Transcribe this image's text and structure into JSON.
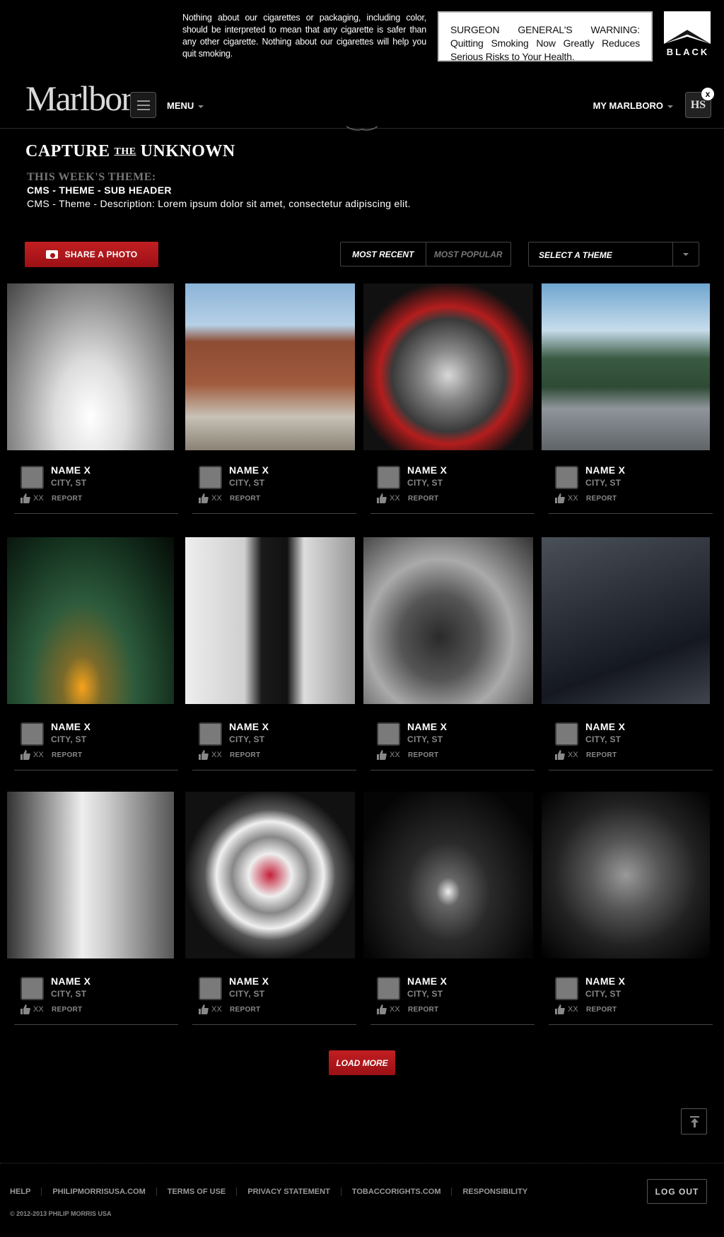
{
  "warning": {
    "disclaimer": "Nothing about our cigarettes or packaging, including color, should be interpreted to mean that any cigarette is safer than any other cigarette. Nothing about our cigarettes will help you quit smoking.",
    "surgeon_general": "SURGEON GENERAL'S WARNING: Quitting Smoking Now Greatly Reduces Serious Risks to Your Health.",
    "black_logo": "BLACK"
  },
  "nav": {
    "brand": "Marlboro",
    "menu_label": "MENU",
    "my_marlboro": "MY MARLBORO",
    "hs_badge": "HS",
    "close": "x"
  },
  "theme": {
    "capture_left": "CAPTURE",
    "capture_the": "THE",
    "capture_right": "UNKNOWN",
    "weeks_theme": "THIS WEEK'S THEME:",
    "sub_header": "CMS - THEME - SUB HEADER",
    "description": "CMS - Theme - Description: Lorem ipsum dolor sit amet, consectetur adipiscing elit."
  },
  "controls": {
    "share": "SHARE A PHOTO",
    "most_recent": "MOST RECENT",
    "most_popular": "MOST POPULAR",
    "select_theme": "SELECT A THEME"
  },
  "photos": [
    {
      "name": "NAME X",
      "city": "CITY, ST",
      "likes": "XX",
      "report": "REPORT",
      "scene": "snowy-forest-road"
    },
    {
      "name": "NAME X",
      "city": "CITY, ST",
      "likes": "XX",
      "report": "REPORT",
      "scene": "canyon-road"
    },
    {
      "name": "NAME X",
      "city": "CITY, ST",
      "likes": "XX",
      "report": "REPORT",
      "scene": "car-engine"
    },
    {
      "name": "NAME X",
      "city": "CITY, ST",
      "likes": "XX",
      "report": "REPORT",
      "scene": "mountain-highway"
    },
    {
      "name": "NAME X",
      "city": "CITY, ST",
      "likes": "XX",
      "report": "REPORT",
      "scene": "sunset-sky"
    },
    {
      "name": "NAME X",
      "city": "CITY, ST",
      "likes": "XX",
      "report": "REPORT",
      "scene": "silhouette-snow-road"
    },
    {
      "name": "NAME X",
      "city": "CITY, ST",
      "likes": "XX",
      "report": "REPORT",
      "scene": "motorcycle"
    },
    {
      "name": "NAME X",
      "city": "CITY, ST",
      "likes": "XX",
      "report": "REPORT",
      "scene": "classic-car"
    },
    {
      "name": "NAME X",
      "city": "CITY, ST",
      "likes": "XX",
      "report": "REPORT",
      "scene": "canal-street"
    },
    {
      "name": "NAME X",
      "city": "CITY, ST",
      "likes": "XX",
      "report": "REPORT",
      "scene": "chrome-hubcap"
    },
    {
      "name": "NAME X",
      "city": "CITY, ST",
      "likes": "XX",
      "report": "REPORT",
      "scene": "night-waterfront"
    },
    {
      "name": "NAME X",
      "city": "CITY, ST",
      "likes": "XX",
      "report": "REPORT",
      "scene": "swamp-tree"
    }
  ],
  "load_more": "LOAD MORE",
  "footer": {
    "links": [
      "HELP",
      "PHILIPMORRISUSA.COM",
      "TERMS OF USE",
      "PRIVACY STATEMENT",
      "TOBACCORIGHTS.COM",
      "RESPONSIBILITY"
    ],
    "logout": "LOG OUT",
    "copyright": "© 2012-2013 PHILIP MORRIS USA"
  },
  "colors": {
    "accent_red": "#b3181c",
    "background": "#000000"
  }
}
